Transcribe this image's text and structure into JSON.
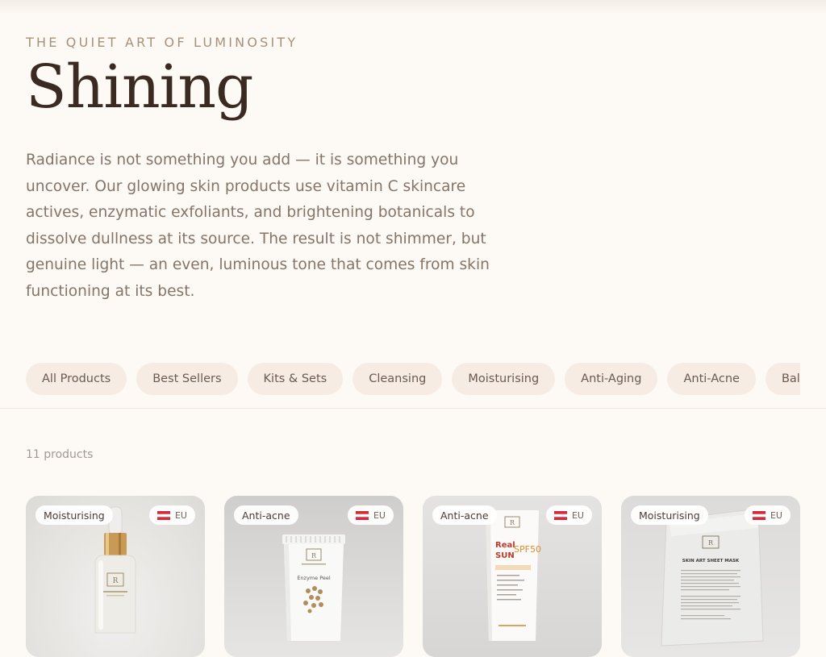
{
  "hero": {
    "eyebrow": "THE QUIET ART OF LUMINOSITY",
    "title": "Shining",
    "description": "Radiance is not something you add — it is something you uncover. Our glowing skin products use vitamin C skincare actives, enzymatic exfoliants, and brightening botanicals to dissolve dullness at its source. The result is not shimmer, but genuine light — an even, luminous tone that comes from skin functioning at its best."
  },
  "filters": [
    "All Products",
    "Best Sellers",
    "Kits & Sets",
    "Cleansing",
    "Moisturising",
    "Anti-Aging",
    "Anti-Acne",
    "Balancing"
  ],
  "product_count": "11 products",
  "products": [
    {
      "category": "Moisturising",
      "region": "EU",
      "kind": "serum-bottle"
    },
    {
      "category": "Anti-acne",
      "region": "EU",
      "kind": "tube",
      "label": "Enzyme Peel"
    },
    {
      "category": "Anti-acne",
      "region": "EU",
      "kind": "sunscreen-tube",
      "label_a": "Real",
      "label_b": "SUN",
      "label_c": "SPF50"
    },
    {
      "category": "Moisturising",
      "region": "EU",
      "kind": "sheet-mask",
      "label": "SKIN ART SHEET MASK"
    }
  ],
  "colors": {
    "background": "#fdf9f4",
    "chip_bg": "#f6ece3",
    "flag_red": "#d9283a",
    "title": "#3b2a22"
  }
}
